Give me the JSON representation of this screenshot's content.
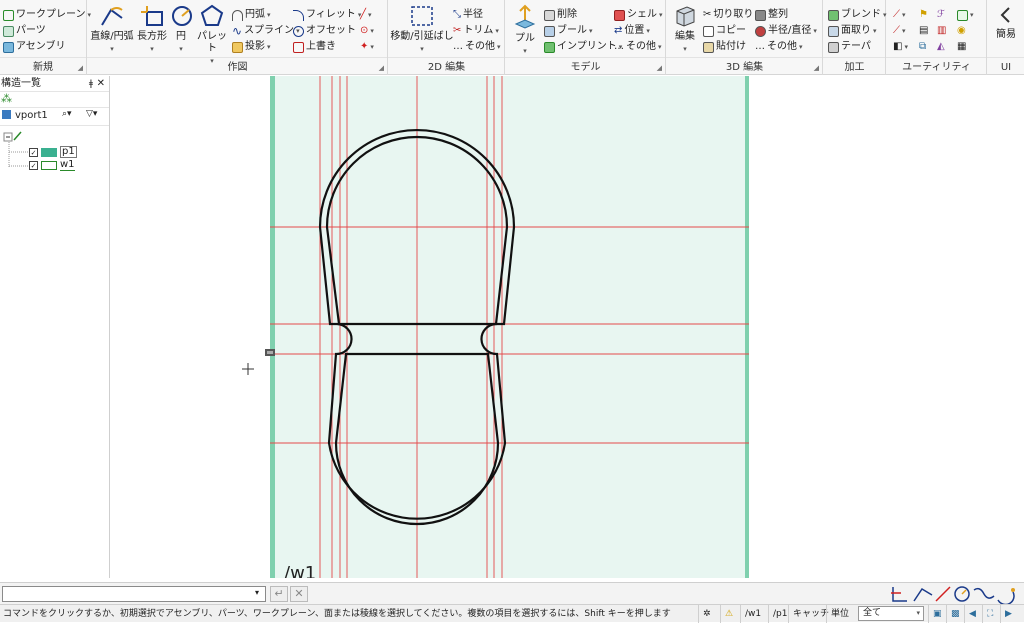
{
  "ribbon": {
    "groups": {
      "new": "新規",
      "sketch": "作図",
      "edit2d": "2D 編集",
      "model": "モデル",
      "edit3d": "3D 編集",
      "process": "加工",
      "utility": "ユーティリティ",
      "ui": "UI"
    },
    "new": {
      "workplane": "ワークプレーン",
      "parts": "パーツ",
      "assembly": "アセンブリ"
    },
    "sketch": {
      "line_arc": "直線/円弧",
      "rectangle": "長方形",
      "circle": "円",
      "palette": "パレット",
      "arc": "円弧",
      "spline": "スプライン",
      "project": "投影",
      "fillet": "フィレット",
      "offset": "オフセット",
      "overwrite": "上書き"
    },
    "edit2d": {
      "move_stretch": "移動/引延ばし",
      "radius": "半径",
      "trim": "トリム",
      "other": "その他"
    },
    "model": {
      "pull": "プル",
      "delete": "削除",
      "boolean": "ブール",
      "imprint": "インプリント",
      "shell": "シェル",
      "position": "位置",
      "other": "その他"
    },
    "edit3d": {
      "edit": "編集",
      "cut": "切り取り",
      "copy": "コピー",
      "paste": "貼付け",
      "align": "整列",
      "radius_diameter": "半径/直径",
      "other": "その他"
    },
    "process": {
      "blend": "ブレンド",
      "chamfer": "面取り",
      "taper": "テーパ"
    },
    "ui": {
      "simple": "簡易"
    }
  },
  "panel": {
    "title": "構造一覧",
    "root": "vport1",
    "items": [
      {
        "label": "p1"
      },
      {
        "label": "w1"
      }
    ]
  },
  "canvas": {
    "sketch_label": "/w1"
  },
  "command": {
    "input_value": "",
    "confirm_symbol": "↵",
    "cancel_symbol": "✕"
  },
  "status": {
    "message": "コマンドをクリックするか、初期選択でアセンブリ、パーツ、ワークプレーン、面または稜線を選択してください。複数の項目を選択するには、Shift キーを押します",
    "workplane": "/w1",
    "part": "/p1",
    "catch": "キャッチ",
    "unit": "単位",
    "filter": "全て"
  },
  "colors": {
    "canvas_bg": "#e8f6f1",
    "canvas_edge": "#7fd0ae",
    "guide": "#e34a4a",
    "profile": "#111111"
  }
}
